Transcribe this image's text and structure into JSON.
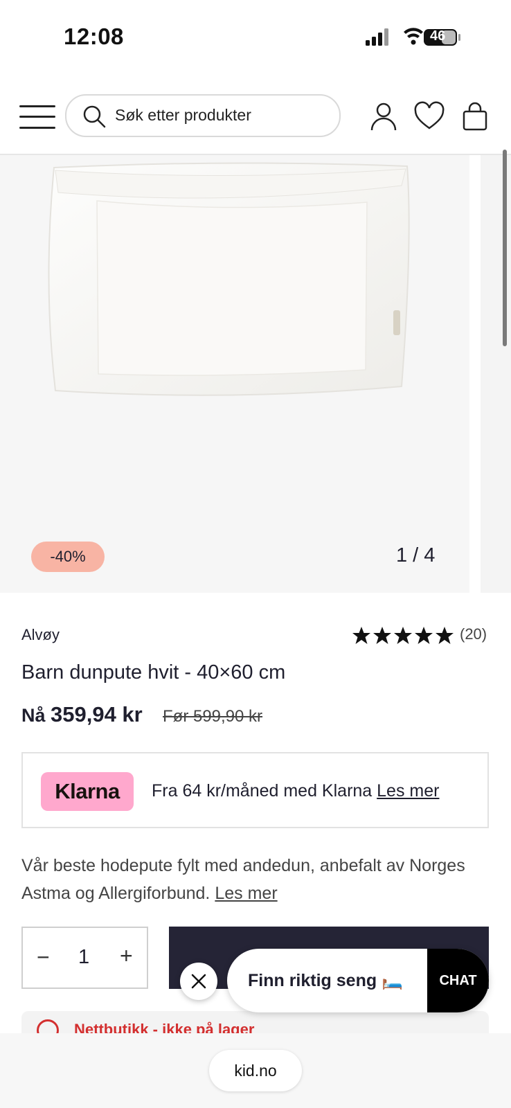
{
  "status_bar": {
    "time": "12:08",
    "battery": "46"
  },
  "header": {
    "search_placeholder": "Søk etter produkter"
  },
  "gallery": {
    "discount": "-40%",
    "counter": "1 / 4"
  },
  "product": {
    "brand": "Alvøy",
    "rating_stars": 5,
    "rating_count": "(20)",
    "title": "Barn dunpute hvit - 40×60 cm",
    "price_now_label": "Nå",
    "price_now": "359,94 kr",
    "price_before": "Før 599,90 kr"
  },
  "klarna": {
    "logo": "Klarna",
    "text": "Fra 64 kr/måned med Klarna",
    "link": "Les mer"
  },
  "description": {
    "text": "Vår beste hodepute fylt med andedun, anbefalt av Norges Astma og Allergiforbund.",
    "link": "Les mer"
  },
  "quantity": {
    "value": "1",
    "minus": "−",
    "plus": "+"
  },
  "info_strip": {
    "text": "Nettbutikk - ikke på lager"
  },
  "widgets": {
    "finn_label": "Finn riktig seng 🛏️",
    "chat_label": "CHAT"
  },
  "browser": {
    "url": "kid.no"
  },
  "colors": {
    "accent": "#252436",
    "discount_bg": "#f8b4a4",
    "klarna_pink": "#ffa8cd"
  }
}
